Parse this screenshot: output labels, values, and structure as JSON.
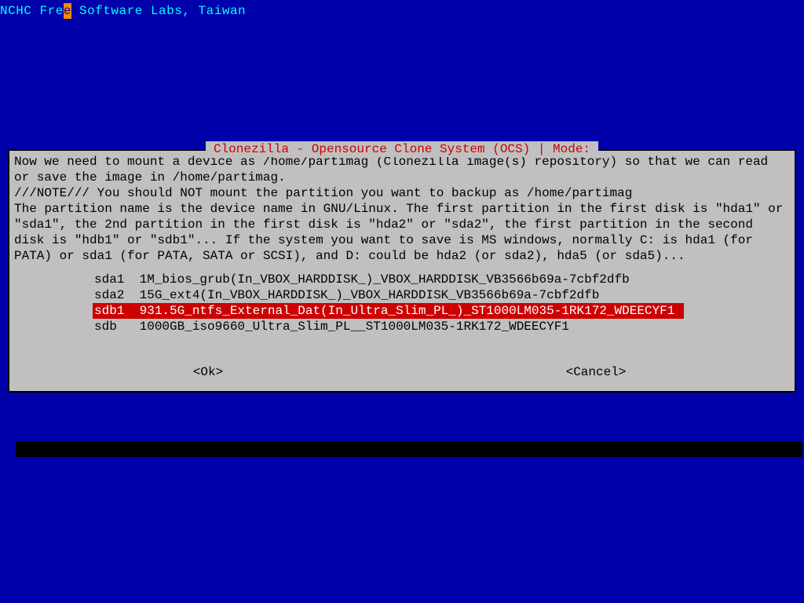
{
  "header": {
    "pre": "NCHC Fre",
    "cursor": "e",
    "post": " Software Labs, Taiwan"
  },
  "dialog": {
    "title": "Clonezilla - Opensource Clone System (OCS) | Mode:",
    "body": "Now we need to mount a device as /home/partimag (Clonezilla image(s) repository) so that we can read or save the image in /home/partimag.\n///NOTE/// You should NOT mount the partition you want to backup as /home/partimag\nThe partition name is the device name in GNU/Linux. The first partition in the first disk is \"hda1\" or \"sda1\", the 2nd partition in the first disk is \"hda2\" or \"sda2\", the first partition in the second disk is \"hdb1\" or \"sdb1\"... If the system you want to save is MS windows, normally C: is hda1 (for PATA) or sda1 (for PATA, SATA or SCSI), and D: could be hda2 (or sda2), hda5 (or sda5)...",
    "options": [
      {
        "dev": "sda1",
        "desc": "1M_bios_grub(In_VBOX_HARDDISK_)_VBOX_HARDDISK_VB3566b69a-7cbf2dfb",
        "selected": false
      },
      {
        "dev": "sda2",
        "desc": "15G_ext4(In_VBOX_HARDDISK_)_VBOX_HARDDISK_VB3566b69a-7cbf2dfb",
        "selected": false
      },
      {
        "dev": "sdb1",
        "desc": "931.5G_ntfs_External_Dat(In_Ultra_Slim_PL_)_ST1000LM035-1RK172_WDEECYF1",
        "selected": true
      },
      {
        "dev": "sdb",
        "desc": "1000GB_iso9660_Ultra_Slim_PL__ST1000LM035-1RK172_WDEECYF1",
        "selected": false
      }
    ],
    "buttons": {
      "ok": "<Ok>",
      "cancel": "<Cancel>"
    }
  }
}
